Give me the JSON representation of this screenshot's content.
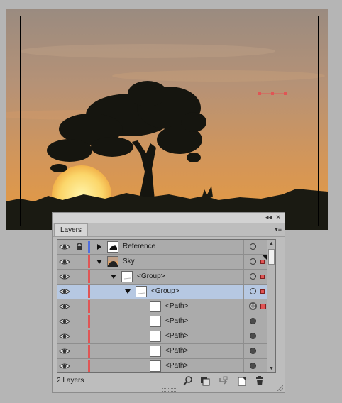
{
  "panel": {
    "tab_label": "Layers",
    "collapse_icon": "double-chevron-icon",
    "close_icon": "close-icon",
    "menu_icon": "panel-menu-icon",
    "layer_count": "2 Layers"
  },
  "layers": [
    {
      "name": "Reference",
      "depth": 0,
      "expanded": false,
      "color": "#4f6fe0",
      "thumb": "reference",
      "target": "hollow",
      "selected": false,
      "selection_square": false
    },
    {
      "name": "Sky",
      "depth": 0,
      "expanded": true,
      "color": "#e05555",
      "thumb": "sky",
      "target": "hollow",
      "selected": false,
      "selection_square": true
    },
    {
      "name": "<Group>",
      "depth": 1,
      "expanded": true,
      "color": "#e05555",
      "thumb": "group",
      "target": "hollow",
      "selected": false,
      "selection_square": true
    },
    {
      "name": "<Group>",
      "depth": 2,
      "expanded": true,
      "color": "#e05555",
      "thumb": "group",
      "target": "hollow",
      "selected": true,
      "selection_square": true
    },
    {
      "name": "<Path>",
      "depth": 3,
      "color": "#e05555",
      "thumb": "blank",
      "target": "double",
      "selected": false,
      "selection_square": true
    },
    {
      "name": "<Path>",
      "depth": 3,
      "color": "#e05555",
      "thumb": "blank",
      "target": "filled",
      "selected": false,
      "selection_square": false
    },
    {
      "name": "<Path>",
      "depth": 3,
      "color": "#e05555",
      "thumb": "blank",
      "target": "filled",
      "selected": false,
      "selection_square": false
    },
    {
      "name": "<Path>",
      "depth": 3,
      "color": "#e05555",
      "thumb": "blank",
      "target": "filled",
      "selected": false,
      "selection_square": false
    },
    {
      "name": "<Path>",
      "depth": 3,
      "color": "#e05555",
      "thumb": "blank",
      "target": "filled",
      "selected": false,
      "selection_square": false
    }
  ],
  "footer_icons": [
    "locate-object-icon",
    "make-clipping-mask-icon",
    "create-sublayer-icon",
    "create-layer-icon",
    "trash-icon"
  ],
  "colors": {
    "selection_highlight": "#b6c8e2",
    "reference_layer_color": "#4f6fe0",
    "sky_layer_color": "#e05555"
  }
}
